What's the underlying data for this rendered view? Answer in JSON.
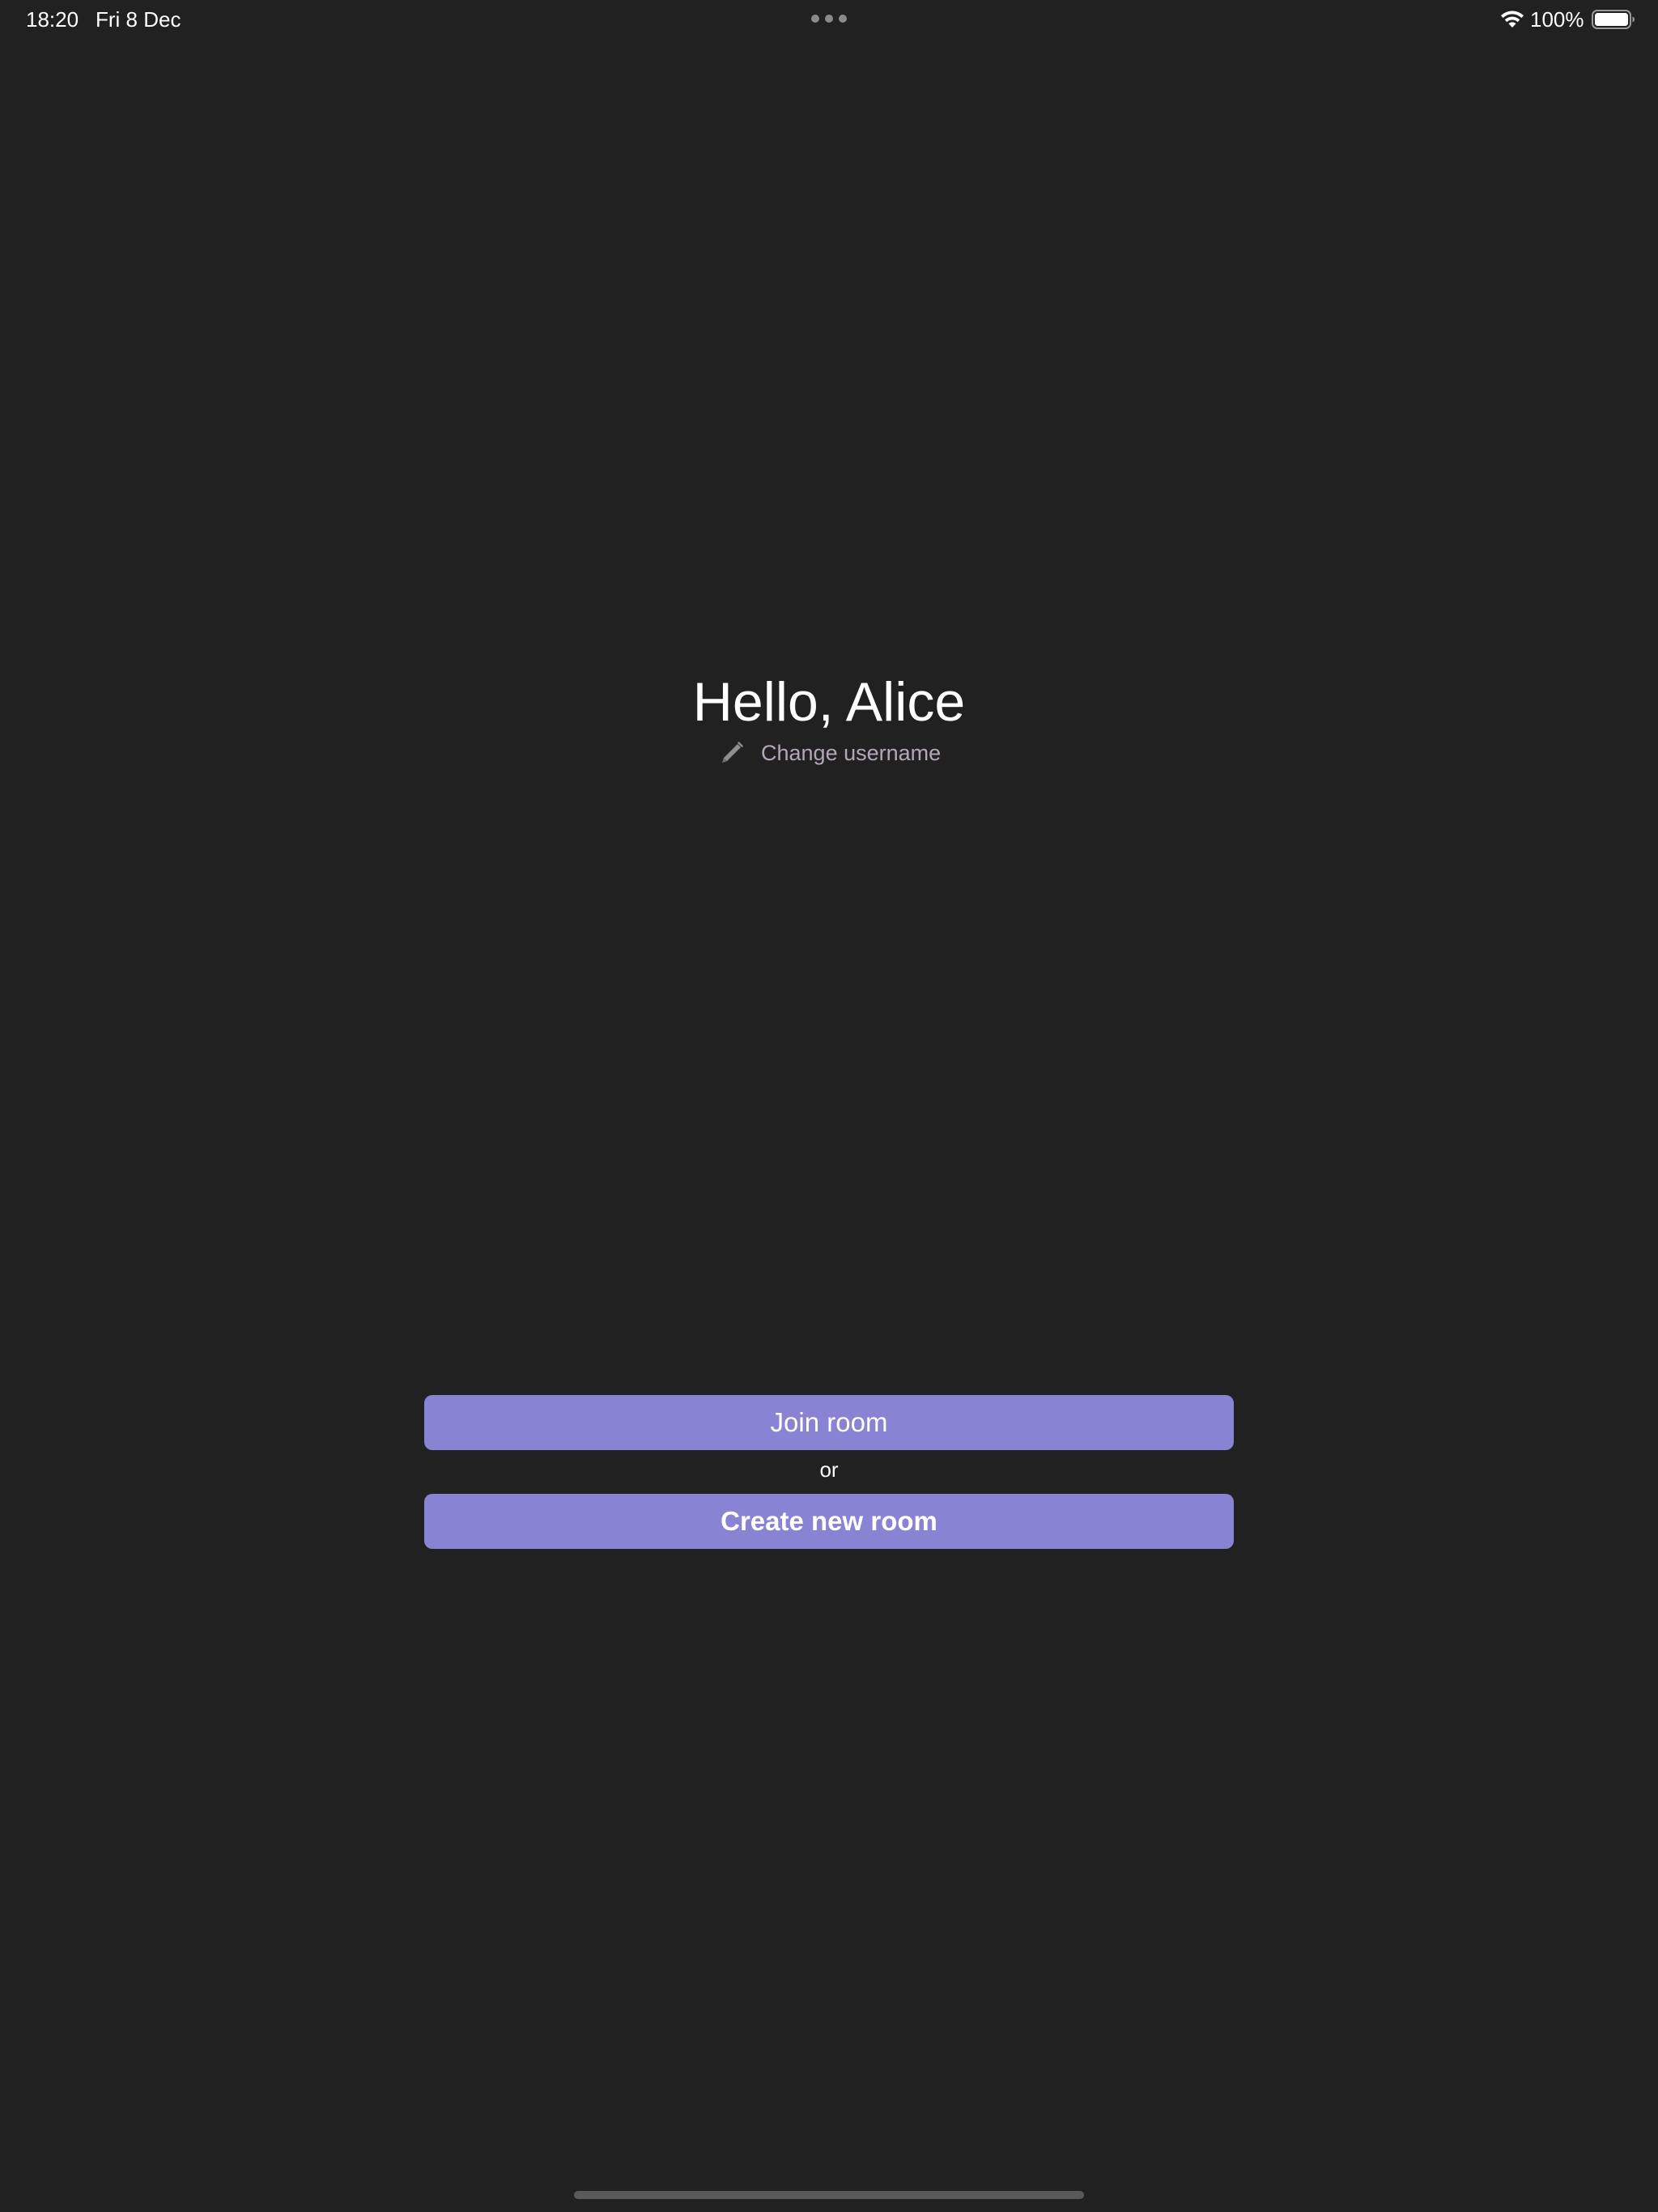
{
  "status_bar": {
    "time": "18:20",
    "date": "Fri 8 Dec",
    "battery_percent": "100%",
    "battery_level": 1.0,
    "icons": [
      "multitasking-dots-icon",
      "wifi-icon",
      "battery-icon"
    ]
  },
  "main": {
    "greeting": "Hello, Alice",
    "change_username_label": "Change username",
    "change_username_icon": "pencil-icon",
    "join_room_label": "Join room",
    "or_label": "or",
    "create_room_label": "Create new room"
  },
  "colors": {
    "background": "#212121",
    "button": "#8883d3",
    "secondary_text": "#b3a6b8"
  }
}
